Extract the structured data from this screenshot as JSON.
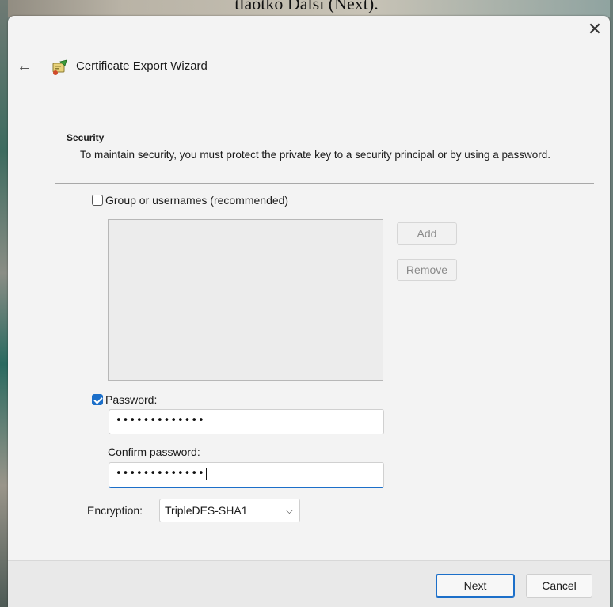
{
  "background": {
    "caption": "tlaotko Dalsi (Next)."
  },
  "wizard": {
    "title": "Certificate Export Wizard",
    "close_glyph": "✕",
    "back_glyph": "←"
  },
  "security": {
    "heading": "Security",
    "description": "To maintain security, you must protect the private key to a security principal or by using a password."
  },
  "group_option": {
    "label": "Group or usernames (recommended)",
    "checked": false
  },
  "buttons": {
    "add": "Add",
    "remove": "Remove",
    "next": "Next",
    "cancel": "Cancel"
  },
  "password_option": {
    "label": "Password:",
    "checked": true,
    "value": "•••••••••••••"
  },
  "confirm": {
    "label": "Confirm password:",
    "value": "•••••••••••••"
  },
  "encryption": {
    "label": "Encryption:",
    "selected": "TripleDES-SHA1"
  },
  "colors": {
    "accent": "#1c6fc9",
    "dialog_bg": "#f3f3f3",
    "footer_bg": "#e9e9e9"
  }
}
